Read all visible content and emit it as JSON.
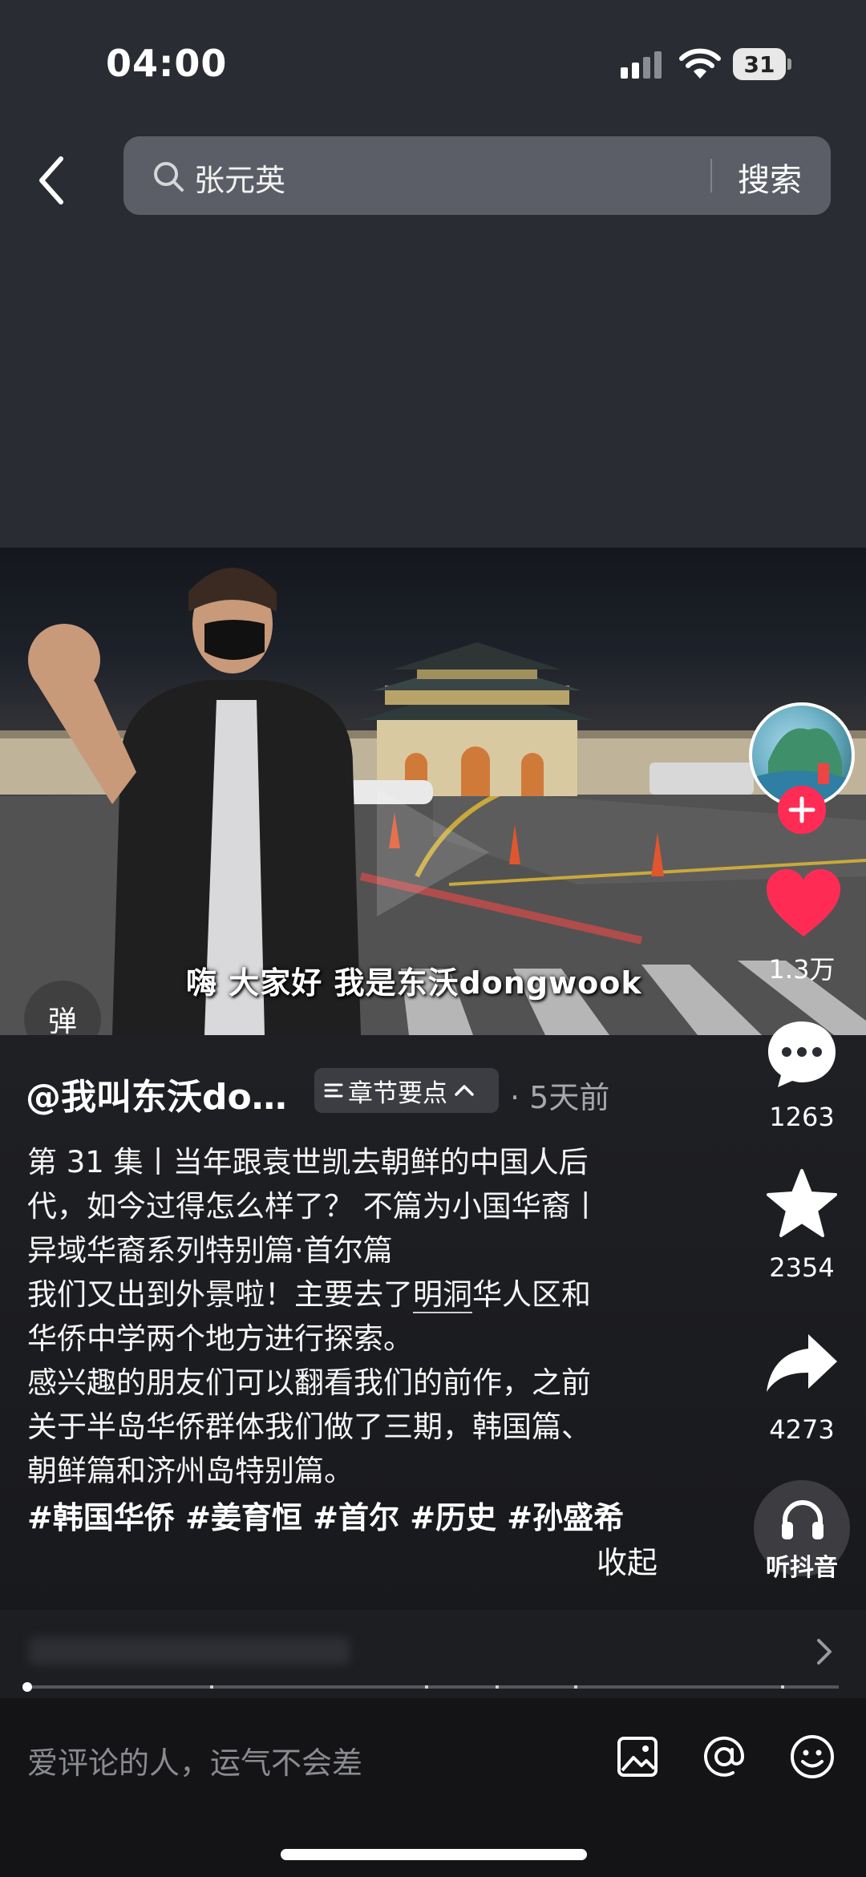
{
  "status_bar": {
    "time": "04:00",
    "battery": "31"
  },
  "search": {
    "query": "张元英",
    "button_label": "搜索"
  },
  "video": {
    "subtitle": "嗨  大家好  我是东沃dongwook",
    "danmaku_label": "弹"
  },
  "author": {
    "name": "@我叫东沃do…",
    "chapter_label": "章节要点",
    "post_time": "· 5天前"
  },
  "caption": {
    "lines": [
      "第 31 集丨当年跟袁世凯去朝鲜的中国人后",
      "代，如今过得怎么样了？ 不篇为小国华裔丨",
      "异域华裔系列特别篇·首尔篇",
      "我们又出到外景啦！主要去了",
      "华侨中学两个地方进行探索。",
      "感兴趣的朋友们可以翻看我们的前作，之前",
      "关于半岛华侨群体我们做了三期，韩国篇、",
      "朝鲜篇和济州岛特别篇。"
    ],
    "link_text": "明洞",
    "line4_tail": "华人区和",
    "hashtags": "#韩国华侨 #姜育恒 #首尔 #历史 #孙盛希",
    "collapse_label": "收起"
  },
  "actions": {
    "likes": "1.3万",
    "comments": "1263",
    "favorites": "2354",
    "shares": "4273",
    "listen_label": "听抖音"
  },
  "comment_bar": {
    "placeholder": "爱评论的人，运气不会差"
  },
  "colors": {
    "like": "#fe2c55",
    "follow": "#fe2c55",
    "background": "#2a2c33"
  }
}
